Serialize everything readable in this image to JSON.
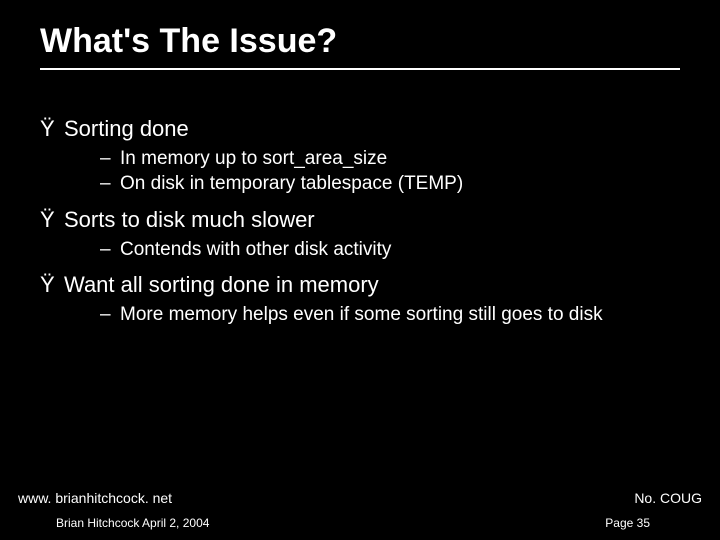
{
  "slide": {
    "title": "What's The Issue?",
    "bullets": [
      {
        "marker": "Ÿ",
        "text": "Sorting done",
        "children": [
          {
            "marker": "–",
            "text": "In memory up to sort_area_size"
          },
          {
            "marker": "–",
            "text": "On disk in temporary tablespace (TEMP)"
          }
        ]
      },
      {
        "marker": "Ÿ",
        "text": "Sorts to disk much slower",
        "children": [
          {
            "marker": "–",
            "text": "Contends with other disk activity"
          }
        ]
      },
      {
        "marker": "Ÿ",
        "text": "Want all sorting done in memory",
        "children": [
          {
            "marker": "–",
            "text": "More memory helps even if some sorting still goes to disk"
          }
        ]
      }
    ]
  },
  "footer": {
    "url": "www. brianhitchcock. net",
    "org": "No. COUG",
    "author": "Brian Hitchcock  April 2, 2004",
    "page": "Page 35"
  }
}
